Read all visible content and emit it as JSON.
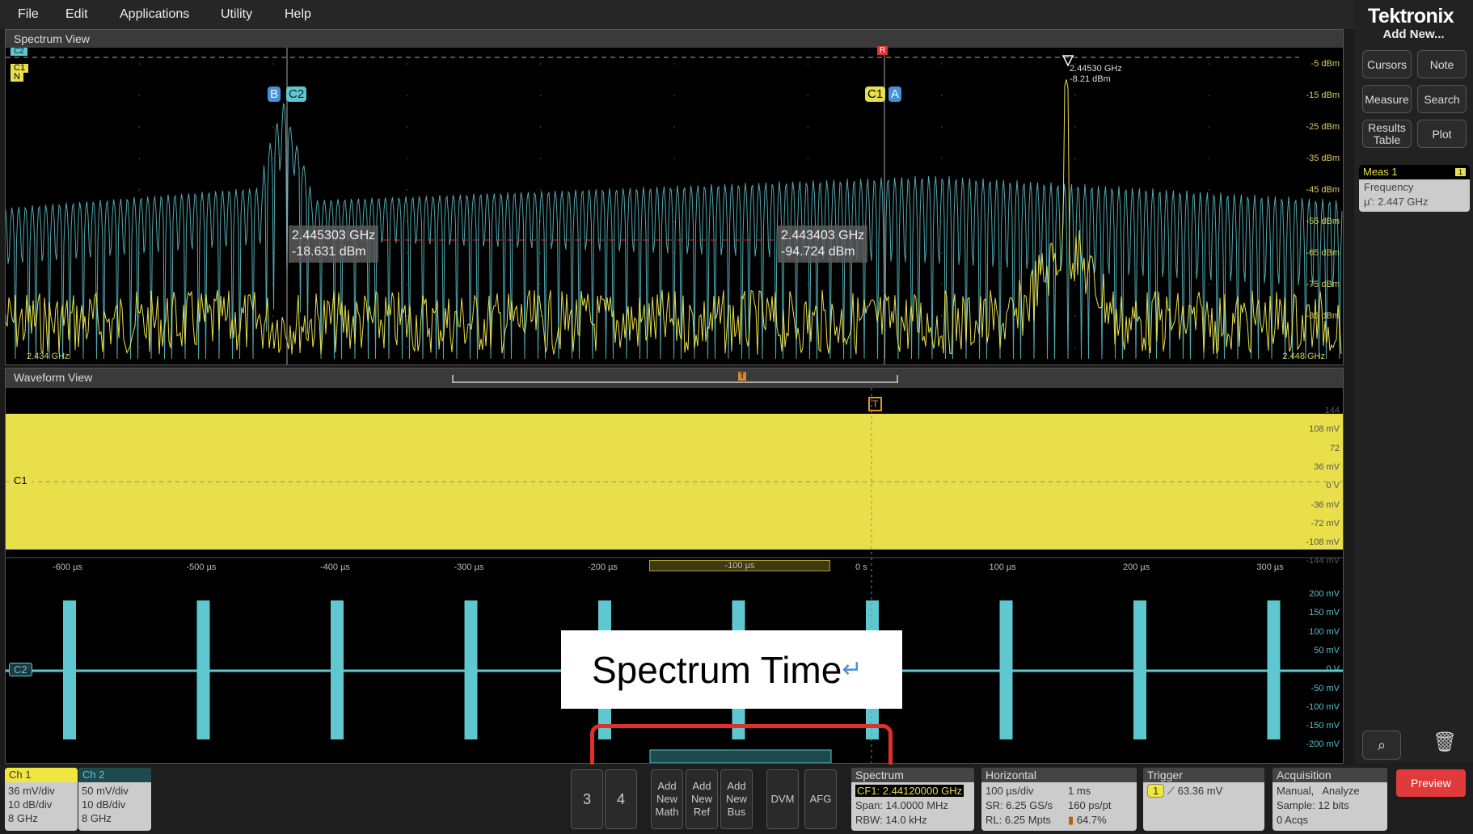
{
  "menu": [
    "File",
    "Edit",
    "Applications",
    "Utility",
    "Help"
  ],
  "brand": "Tektronix",
  "right_panel": {
    "add_new": "Add New...",
    "buttons": [
      "Cursors",
      "Note",
      "Measure",
      "Search",
      "Results Table",
      "Plot"
    ],
    "meas": {
      "title": "Meas 1",
      "badge": "1",
      "name": "Frequency",
      "value": "µ': 2.447 GHz"
    }
  },
  "spectrum": {
    "title": "Spectrum View",
    "ylabels": [
      "-5 dBm",
      "-15 dBm",
      "-25 dBm",
      "-35 dBm",
      "-45 dBm",
      "-55 dBm",
      "-65 dBm",
      "-75 dBm",
      "-85 dBm"
    ],
    "x_start": "2.434 GHz",
    "x_end": "2.448 GHz",
    "cursor_a": {
      "freq": "2.445303 GHz",
      "level": "-18.631 dBm"
    },
    "cursor_b": {
      "freq": "2.443403 GHz",
      "level": "-94.724 dBm"
    },
    "peak": {
      "freq": "2.44530 GHz",
      "level": "-8.21 dBm"
    },
    "tags": {
      "b": "B",
      "c2": "C2",
      "c1": "C1",
      "a": "A",
      "r": "R",
      "ch2": "C2",
      "ch1": "C1",
      "n": "N"
    },
    "colors": {
      "ch1": "#e8df4a",
      "ch2": "#5fc7cf"
    }
  },
  "waveform": {
    "title": "Waveform View",
    "trigger": "T",
    "c1_labels": [
      "144",
      "108 mV",
      "72",
      "36 mV",
      "0 V",
      "-36 mV",
      "-72 mV",
      "-108 mV",
      "-144 mV"
    ],
    "time_labels": [
      "-600 µs",
      "-500 µs",
      "-400 µs",
      "-300 µs",
      "-200 µs",
      "-100 µs",
      "0 s",
      "100 µs",
      "200 µs",
      "300 µs"
    ],
    "c2_labels": [
      "200 mV",
      "150 mV",
      "100 mV",
      "50 mV",
      "0 V",
      "-50 mV",
      "-100 mV",
      "-150 mV",
      "-200 mV"
    ],
    "c1_tag": "C1",
    "c2_tag": "C2"
  },
  "overlay": {
    "text": "Spectrum Time"
  },
  "bottom": {
    "ch1": {
      "label": "Ch 1",
      "lines": [
        "36 mV/div",
        "10 dB/div",
        "8 GHz"
      ]
    },
    "ch2": {
      "label": "Ch 2",
      "lines": [
        "50 mV/div",
        "10 dB/div",
        "8 GHz"
      ]
    },
    "buttons": [
      "3",
      "4",
      "Add New Math",
      "Add New Ref",
      "Add New Bus",
      "DVM",
      "AFG"
    ],
    "spectrum": {
      "title": "Spectrum",
      "cf": "CF1: 2.44120000 GHz",
      "span": "Span: 14.0000 MHz",
      "rbw": "RBW: 14.0 kHz"
    },
    "horizontal": {
      "title": "Horizontal",
      "a": "100 µs/div",
      "b": "1 ms",
      "c": "SR: 6.25 GS/s",
      "d": "160 ps/pt",
      "e": "RL: 6.25 Mpts",
      "f": "64.7%"
    },
    "trigger": {
      "title": "Trigger",
      "src": "1",
      "level": "63.36 mV"
    },
    "acquisition": {
      "title": "Acquisition",
      "a": "Manual,",
      "b": "Analyze",
      "c": "Sample: 12 bits",
      "d": "0 Acqs"
    },
    "preview": "Preview"
  }
}
